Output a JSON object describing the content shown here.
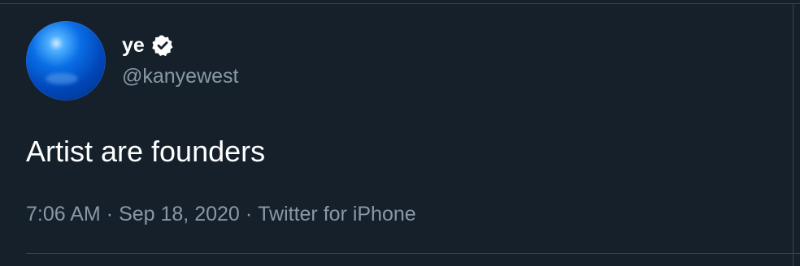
{
  "tweet": {
    "display_name": "ye",
    "handle": "@kanyewest",
    "text": "Artist are founders",
    "time": "7:06 AM",
    "separator": "·",
    "date": "Sep 18, 2020",
    "source": "Twitter for iPhone"
  },
  "icons": {
    "verified": "verified-badge-icon"
  },
  "colors": {
    "background": "#15202b",
    "text_primary": "#ffffff",
    "text_secondary": "#8899a6",
    "divider": "#38444d"
  }
}
